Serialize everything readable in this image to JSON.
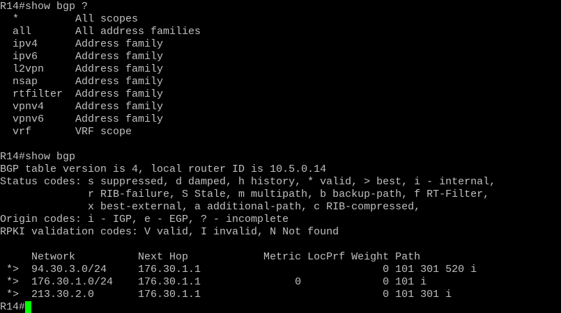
{
  "terminal": {
    "lines": [
      "R14#show bgp ?",
      "  *         All scopes",
      "  all       All address families",
      "  ipv4      Address family",
      "  ipv6      Address family",
      "  l2vpn     Address family",
      "  nsap      Address family",
      "  rtfilter  Address family",
      "  vpnv4     Address family",
      "  vpnv6     Address family",
      "  vrf       VRF scope",
      "",
      "R14#show bgp",
      "BGP table version is 4, local router ID is 10.5.0.14",
      "Status codes: s suppressed, d damped, h history, * valid, > best, i - internal,",
      "              r RIB-failure, S Stale, m multipath, b backup-path, f RT-Filter,",
      "              x best-external, a additional-path, c RIB-compressed,",
      "Origin codes: i - IGP, e - EGP, ? - incomplete",
      "RPKI validation codes: V valid, I invalid, N Not found",
      "",
      "     Network          Next Hop            Metric LocPrf Weight Path",
      " *>  94.30.3.0/24     176.30.1.1                             0 101 301 520 i",
      " *>  176.30.1.0/24    176.30.1.1               0             0 101 i",
      " *>  213.30.2.0       176.30.1.1                             0 101 301 i"
    ],
    "prompt": "R14#",
    "cursor_color": "#00ff00",
    "text_color": "#c0c0c0",
    "background_color": "#000000"
  }
}
